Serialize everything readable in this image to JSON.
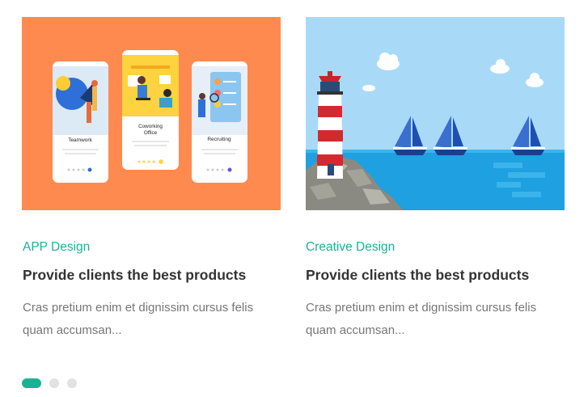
{
  "cards": [
    {
      "category": "APP Design",
      "title": "Provide clients the best products",
      "excerpt": "Cras pretium enim et dignissim cursus felis quam accumsan...",
      "image": {
        "phone_labels": [
          "Teamwork",
          "Coworking Office",
          "Recruiting"
        ]
      }
    },
    {
      "category": "Creative Design",
      "title": "Provide clients the best products",
      "excerpt": "Cras pretium enim et dignissim cursus felis quam accumsan..."
    }
  ],
  "carousel": {
    "slide_count": 3,
    "active_index": 0
  },
  "colors": {
    "accent": "#19b394",
    "title": "#333333",
    "excerpt": "#767676",
    "dot_inactive": "#e2e2e2",
    "card1_bg": "#ff8a50",
    "card2_sky": "#a8daf7",
    "card2_sea": "#1fa0e0"
  }
}
